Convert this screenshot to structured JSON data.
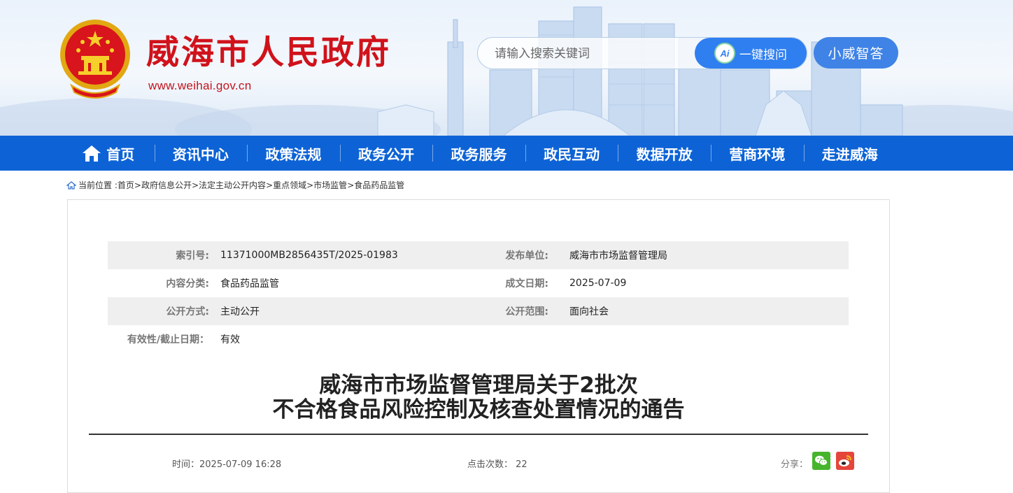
{
  "header": {
    "site_title": "威海市人民政府",
    "site_url": "www.weihai.gov.cn",
    "search_placeholder": "请输入搜索关键词",
    "search_button_label": "一键搜问",
    "ai_badge": "Ai",
    "assistant_button_label": "小威智答"
  },
  "nav": {
    "items": [
      "首页",
      "资讯中心",
      "政策法规",
      "政务公开",
      "政务服务",
      "政民互动",
      "数据开放",
      "营商环境",
      "走进威海"
    ]
  },
  "breadcrumb": {
    "prefix": "当前位置 :",
    "items": [
      "首页",
      "政府信息公开",
      "法定主动公开内容",
      "重点领域",
      "市场监管",
      "食品药品监管"
    ],
    "separator": ">"
  },
  "meta": {
    "index_label": "索引号:",
    "index_value": "11371000MB2856435T/2025-01983",
    "publisher_label": "发布单位:",
    "publisher_value": "威海市市场监督管理局",
    "category_label": "内容分类:",
    "category_value": "食品药品监管",
    "date_label": "成文日期:",
    "date_value": "2025-07-09",
    "mode_label": "公开方式:",
    "mode_value": "主动公开",
    "scope_label": "公开范围:",
    "scope_value": "面向社会",
    "validity_label": "有效性/截止日期：",
    "validity_value": "有效"
  },
  "article": {
    "title_line1": "威海市市场监督管理局关于2批次",
    "title_line2": "不合格食品风险控制及核查处置情况的通告",
    "time_text": "时间：2025-07-09 16:28",
    "clicks_label": "点击次数：",
    "clicks_value": "22",
    "share_label": "分享："
  },
  "colors": {
    "brand_red": "#d0121b",
    "nav_blue": "#0d63d6",
    "search_blue": "#2f7ff0",
    "wechat_green": "#46b52c",
    "weibo_red": "#e4463c"
  },
  "icons": [
    "national-emblem",
    "ai-icon",
    "home-icon",
    "breadcrumb-home-icon",
    "wechat-icon",
    "weibo-icon"
  ]
}
